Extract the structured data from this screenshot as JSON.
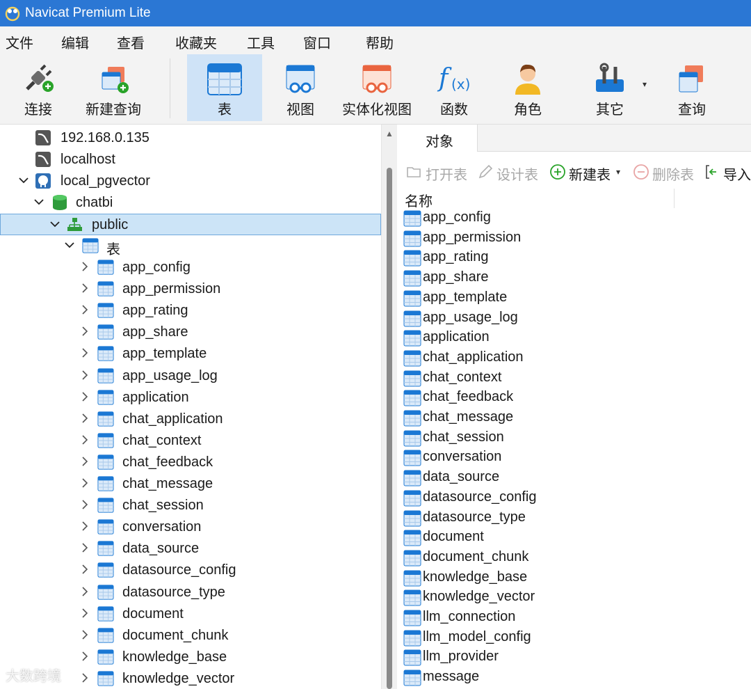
{
  "window": {
    "title": "Navicat Premium Lite"
  },
  "menu": [
    "文件",
    "编辑",
    "查看",
    "收藏夹",
    "工具",
    "窗口",
    "帮助"
  ],
  "toolbar": [
    {
      "label": "连接",
      "icon": "connection-plug-icon"
    },
    {
      "label": "新建查询",
      "icon": "new-query-icon"
    },
    {
      "label": "表",
      "icon": "table-icon",
      "active": true
    },
    {
      "label": "视图",
      "icon": "view-icon"
    },
    {
      "label": "实体化视图",
      "icon": "materialized-view-icon"
    },
    {
      "label": "函数",
      "icon": "function-icon"
    },
    {
      "label": "角色",
      "icon": "role-user-icon"
    },
    {
      "label": "其它",
      "icon": "tools-icon"
    },
    {
      "label": "查询",
      "icon": "query-icon"
    }
  ],
  "tree": {
    "connections": [
      "192.168.0.135",
      "localhost",
      "local_pgvector"
    ],
    "database": "chatbi",
    "schema": "public",
    "tables_group": "表",
    "tables": [
      "app_config",
      "app_permission",
      "app_rating",
      "app_share",
      "app_template",
      "app_usage_log",
      "application",
      "chat_application",
      "chat_context",
      "chat_feedback",
      "chat_message",
      "chat_session",
      "conversation",
      "data_source",
      "datasource_config",
      "datasource_type",
      "document",
      "document_chunk",
      "knowledge_base",
      "knowledge_vector"
    ]
  },
  "objects": {
    "tab": "对象",
    "actions": {
      "open": "打开表",
      "design": "设计表",
      "new": "新建表",
      "delete": "删除表",
      "import": "导入"
    },
    "column_name": "名称",
    "items": [
      "app_config",
      "app_permission",
      "app_rating",
      "app_share",
      "app_template",
      "app_usage_log",
      "application",
      "chat_application",
      "chat_context",
      "chat_feedback",
      "chat_message",
      "chat_session",
      "conversation",
      "data_source",
      "datasource_config",
      "datasource_type",
      "document",
      "document_chunk",
      "knowledge_base",
      "knowledge_vector",
      "llm_connection",
      "llm_model_config",
      "llm_provider",
      "message"
    ]
  },
  "watermark": "大数跨境",
  "colors": {
    "titlebar": "#2b77d4",
    "active_tool": "#cfe3f7",
    "selected_row": "#cce4f7",
    "table_icon_blue": "#1b78d4"
  }
}
